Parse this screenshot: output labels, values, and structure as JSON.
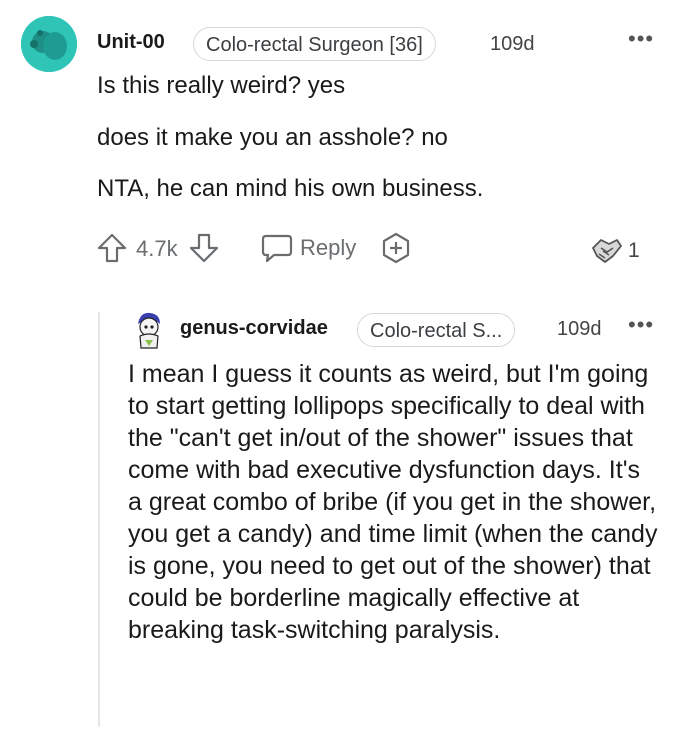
{
  "comment": {
    "username": "Unit-00",
    "flair": "Colo-rectal Surgeon [36]",
    "age": "109d",
    "more_icon": "more-dots-icon",
    "lines": [
      "Is this really weird? yes",
      "does it make you an asshole? no",
      "NTA, he can mind his own business."
    ],
    "upvote_count": "4.7k",
    "reply_label": "Reply",
    "award_count": "1"
  },
  "reply": {
    "username": "genus-corvidae",
    "flair": "Colo-rectal S...",
    "age": "109d",
    "text": "I mean I guess it counts as weird, but I'm going to start getting lollipops specifically to deal with the \"can't get in/out of the shower\" issues that come with bad executive dysfunction days. It's a great combo of bribe (if you get in the shower, you get a candy) and time limit (when the candy is gone, you need to get out of the shower) that could be borderline magically effective at breaking task-switching paralysis."
  },
  "colors": {
    "avatar_bg": "#2ec4b6",
    "text": "#1a1a1b",
    "muted": "#6a6d70"
  }
}
